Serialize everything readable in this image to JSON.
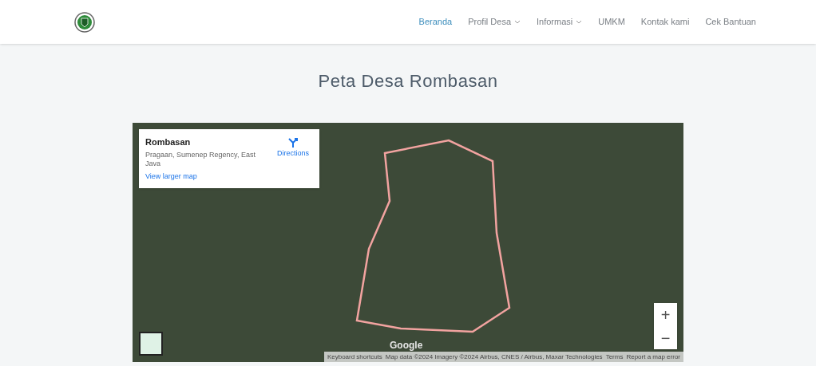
{
  "nav": {
    "items": [
      {
        "label": "Beranda",
        "selected": true,
        "dropdown": false
      },
      {
        "label": "Profil Desa",
        "selected": false,
        "dropdown": true
      },
      {
        "label": "Informasi",
        "selected": false,
        "dropdown": true
      },
      {
        "label": "UMKM",
        "selected": false,
        "dropdown": false
      },
      {
        "label": "Kontak kami",
        "selected": false,
        "dropdown": false
      },
      {
        "label": "Cek Bantuan",
        "selected": false,
        "dropdown": false
      }
    ]
  },
  "page_title": "Peta Desa Rombasan",
  "map": {
    "place_card": {
      "title": "Rombasan",
      "address": "Pragaan, Sumenep Regency, East Java",
      "directions": "Directions",
      "larger_map_link": "View larger map"
    },
    "zoom_in": "+",
    "zoom_out": "−",
    "logo": "Google",
    "attribution": [
      "Keyboard shortcuts",
      "Map data ©2024 Imagery ©2024 Airbus, CNES / Airbus, Maxar Technologies",
      "Terms",
      "Report a map error"
    ]
  }
}
